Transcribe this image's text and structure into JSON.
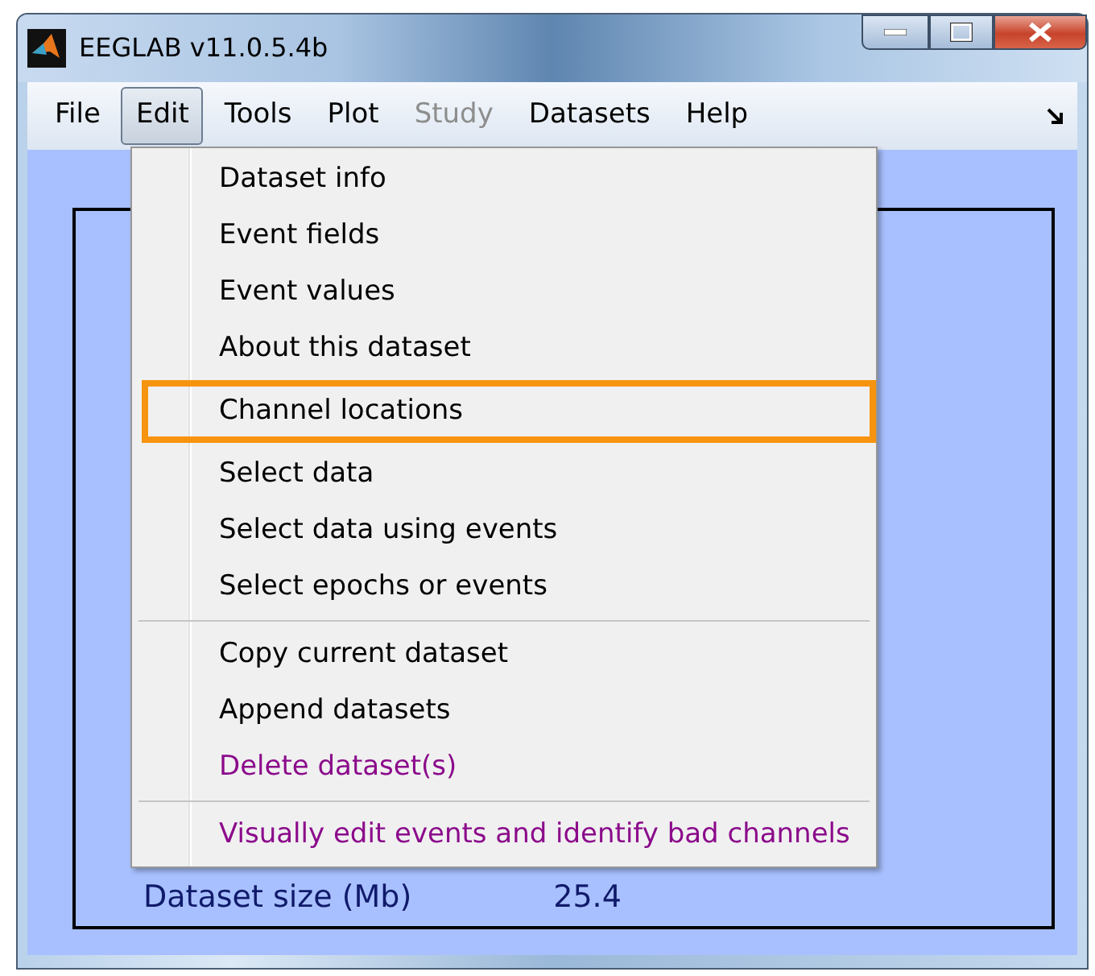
{
  "window": {
    "title": "EEGLAB v11.0.5.4b"
  },
  "menubar": [
    {
      "label": "File",
      "selected": false,
      "disabled": false
    },
    {
      "label": "Edit",
      "selected": true,
      "disabled": false
    },
    {
      "label": "Tools",
      "selected": false,
      "disabled": false
    },
    {
      "label": "Plot",
      "selected": false,
      "disabled": false
    },
    {
      "label": "Study",
      "selected": false,
      "disabled": true
    },
    {
      "label": "Datasets",
      "selected": false,
      "disabled": false
    },
    {
      "label": "Help",
      "selected": false,
      "disabled": false
    }
  ],
  "edit_menu": {
    "groups": [
      [
        {
          "label": "Dataset info",
          "color": "#000000",
          "highlighted": false
        },
        {
          "label": "Event fields",
          "color": "#000000",
          "highlighted": false
        },
        {
          "label": "Event values",
          "color": "#000000",
          "highlighted": false
        },
        {
          "label": "About this dataset",
          "color": "#000000",
          "highlighted": false
        },
        {
          "label": "Channel locations",
          "color": "#000000",
          "highlighted": true
        },
        {
          "label": "Select data",
          "color": "#000000",
          "highlighted": false
        },
        {
          "label": "Select data using events",
          "color": "#000000",
          "highlighted": false
        },
        {
          "label": "Select epochs or events",
          "color": "#000000",
          "highlighted": false
        }
      ],
      [
        {
          "label": "Copy current dataset",
          "color": "#000000",
          "highlighted": false
        },
        {
          "label": "Append datasets",
          "color": "#000000",
          "highlighted": false
        },
        {
          "label": "Delete dataset(s)",
          "color": "#8b0a8b",
          "highlighted": false
        }
      ],
      [
        {
          "label": "Visually edit events and identify bad channels",
          "color": "#8b0a8b",
          "highlighted": false
        }
      ]
    ]
  },
  "info_panel": {
    "rows": [
      {
        "label": "Dataset size (Mb)",
        "value": "25.4"
      }
    ]
  }
}
